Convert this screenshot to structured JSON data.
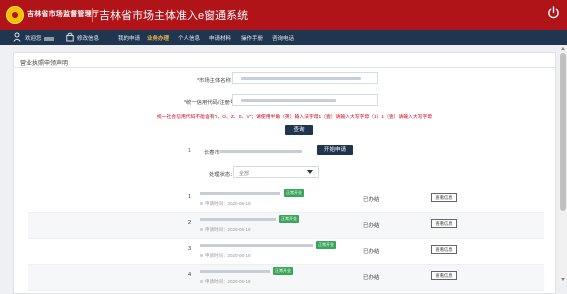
{
  "header": {
    "org_name": "吉林省市场监督管理厅",
    "app_title": "吉林省市场主体准入e窗通系统"
  },
  "nav": {
    "welcome": "欢迎您",
    "items": [
      {
        "label": "修改信息",
        "active": false
      },
      {
        "label": "我的申请",
        "active": false
      },
      {
        "label": "业务办理",
        "active": true
      },
      {
        "label": "个人信息",
        "active": false
      },
      {
        "label": "申请材料",
        "active": false
      },
      {
        "label": "操作手册",
        "active": false
      },
      {
        "label": "咨询电话",
        "active": false
      }
    ]
  },
  "panel": {
    "title": "营业执照申领声明",
    "form": {
      "name_label": "*市场主体名称：",
      "code_label": "*统一信用代码/注册号：",
      "hint": "统一社会信用代码不能含有“I、O、Z、S、V”；请使用半角（英）输入法字母1（壹）请输入大写字母（1）1（壹）请输入大写字母",
      "query_button": "查询"
    },
    "result": {
      "index": "1",
      "text_prefix": "长春市",
      "start_button": "开始申请"
    },
    "filter": {
      "label": "处理状态：",
      "selected": "全部"
    },
    "records": [
      {
        "index": "1",
        "badge": "正常开业",
        "date_label": "申请时间：2020-06-19",
        "status": "已办结",
        "action": "查看信息"
      },
      {
        "index": "2",
        "badge": "正常开业",
        "date_label": "申请时间：2020-06-19",
        "status": "已办结",
        "action": "查看信息"
      },
      {
        "index": "3",
        "badge": "正常开业",
        "date_label": "申请时间：2020-06-19",
        "status": "已办结",
        "action": "查看信息"
      },
      {
        "index": "4",
        "badge": "正常开业",
        "date_label": "申请时间：2020-06-19",
        "status": "已办结",
        "action": "查看信息"
      }
    ]
  },
  "colors": {
    "header_red": "#b01418",
    "nav_navy": "#1f3550",
    "active_orange": "#f0b34a",
    "badge_green": "#3aa55a",
    "hint_red": "#d0021b"
  },
  "icons": [
    "emblem-icon",
    "power-icon",
    "user-icon",
    "edit-info-icon",
    "dropdown-caret-icon"
  ]
}
